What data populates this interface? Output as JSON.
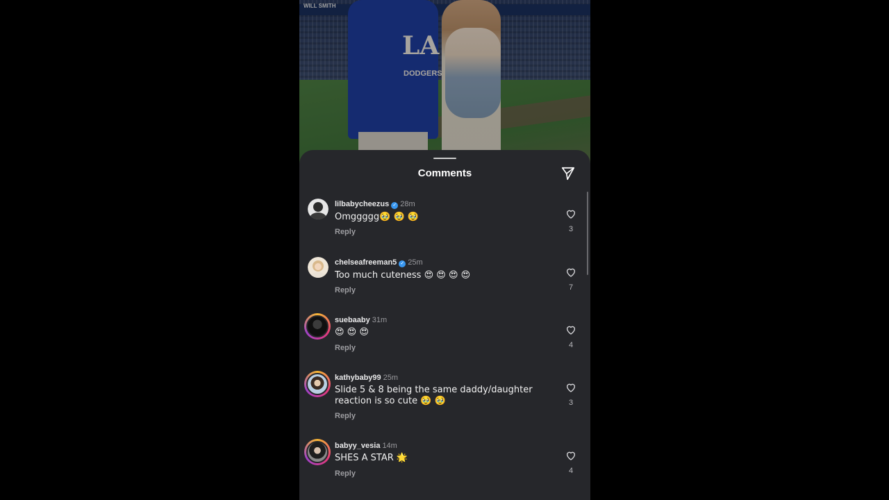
{
  "photo": {
    "banner_text": "WILL SMITH",
    "jersey_logo": "LA",
    "jersey_text": "DODGERS"
  },
  "sheet": {
    "title": "Comments",
    "send_icon": "paper-plane-icon"
  },
  "comments": [
    {
      "username": "lilbabycheezus",
      "verified": true,
      "time": "28m",
      "text": "Omggggg🥹 🥹 🥹",
      "reply": "Reply",
      "likes": "3",
      "avatar_colors": [
        "#444",
        "#ddd"
      ]
    },
    {
      "username": "chelseafreeman5",
      "verified": true,
      "time": "25m",
      "text": "Too much cuteness 😍 😍 😍 😍",
      "reply": "Reply",
      "likes": "7",
      "avatar_colors": [
        "#c9b8a0",
        "#e8dcc8"
      ]
    },
    {
      "username": "suebaaby",
      "verified": false,
      "time": "31m",
      "text": "😍 😍 😍",
      "reply": "Reply",
      "likes": "4",
      "avatar_colors": [
        "#111",
        "#333"
      ]
    },
    {
      "username": "kathybaby99",
      "verified": false,
      "time": "25m",
      "text": "Slide 5 & 8 being the same daddy/daughter reaction is so cute 🥹 🥹",
      "reply": "Reply",
      "likes": "3",
      "avatar_colors": [
        "#a8c6e0",
        "#3a3a3a"
      ]
    },
    {
      "username": "babyy_vesia",
      "verified": false,
      "time": "14m",
      "text": "SHES A STAR 🌟",
      "reply": "Reply",
      "likes": "4",
      "avatar_colors": [
        "#2a2a2a",
        "#bfbfbf"
      ]
    }
  ]
}
